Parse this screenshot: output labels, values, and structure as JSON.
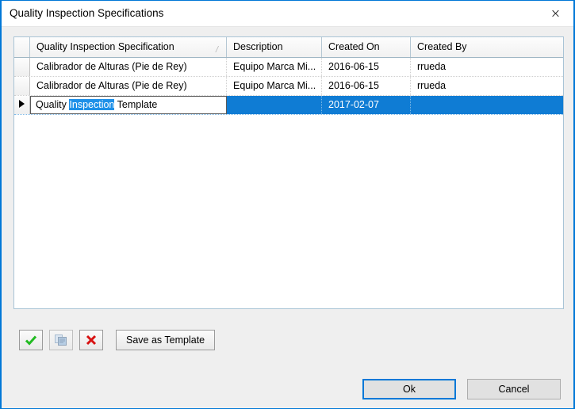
{
  "window": {
    "title": "Quality Inspection Specifications",
    "close_label": "×",
    "accent_color": "#0078d7"
  },
  "grid": {
    "columns": [
      {
        "label": "Quality Inspection Specification",
        "sort_indicator": "/"
      },
      {
        "label": "Description"
      },
      {
        "label": "Created On"
      },
      {
        "label": "Created By"
      }
    ],
    "rows": [
      {
        "name": "Calibrador de Alturas (Pie de Rey)",
        "description": "Equipo Marca Mi...",
        "created_on": "2016-06-15",
        "created_by": "rrueda",
        "selected": false,
        "current": false,
        "editing": false
      },
      {
        "name": "Calibrador de Alturas (Pie de Rey)",
        "description": "Equipo Marca Mi...",
        "created_on": "2016-06-15",
        "created_by": "rrueda",
        "selected": false,
        "current": false,
        "editing": false
      },
      {
        "name": "Quality Inspection Template",
        "description": "",
        "created_on": "2017-02-07",
        "created_by": "",
        "selected": true,
        "current": true,
        "editing": true,
        "edit_text_before": "Quality ",
        "edit_text_selected": "Inspection",
        "edit_text_after": " Template"
      }
    ],
    "selection_color": "#0f7cd4"
  },
  "toolbar": {
    "accept_label": "✓",
    "duplicate_label": "",
    "cancel_label": "✕",
    "save_as_template_label": "Save as Template"
  },
  "footer": {
    "ok_label": "Ok",
    "cancel_label": "Cancel"
  }
}
